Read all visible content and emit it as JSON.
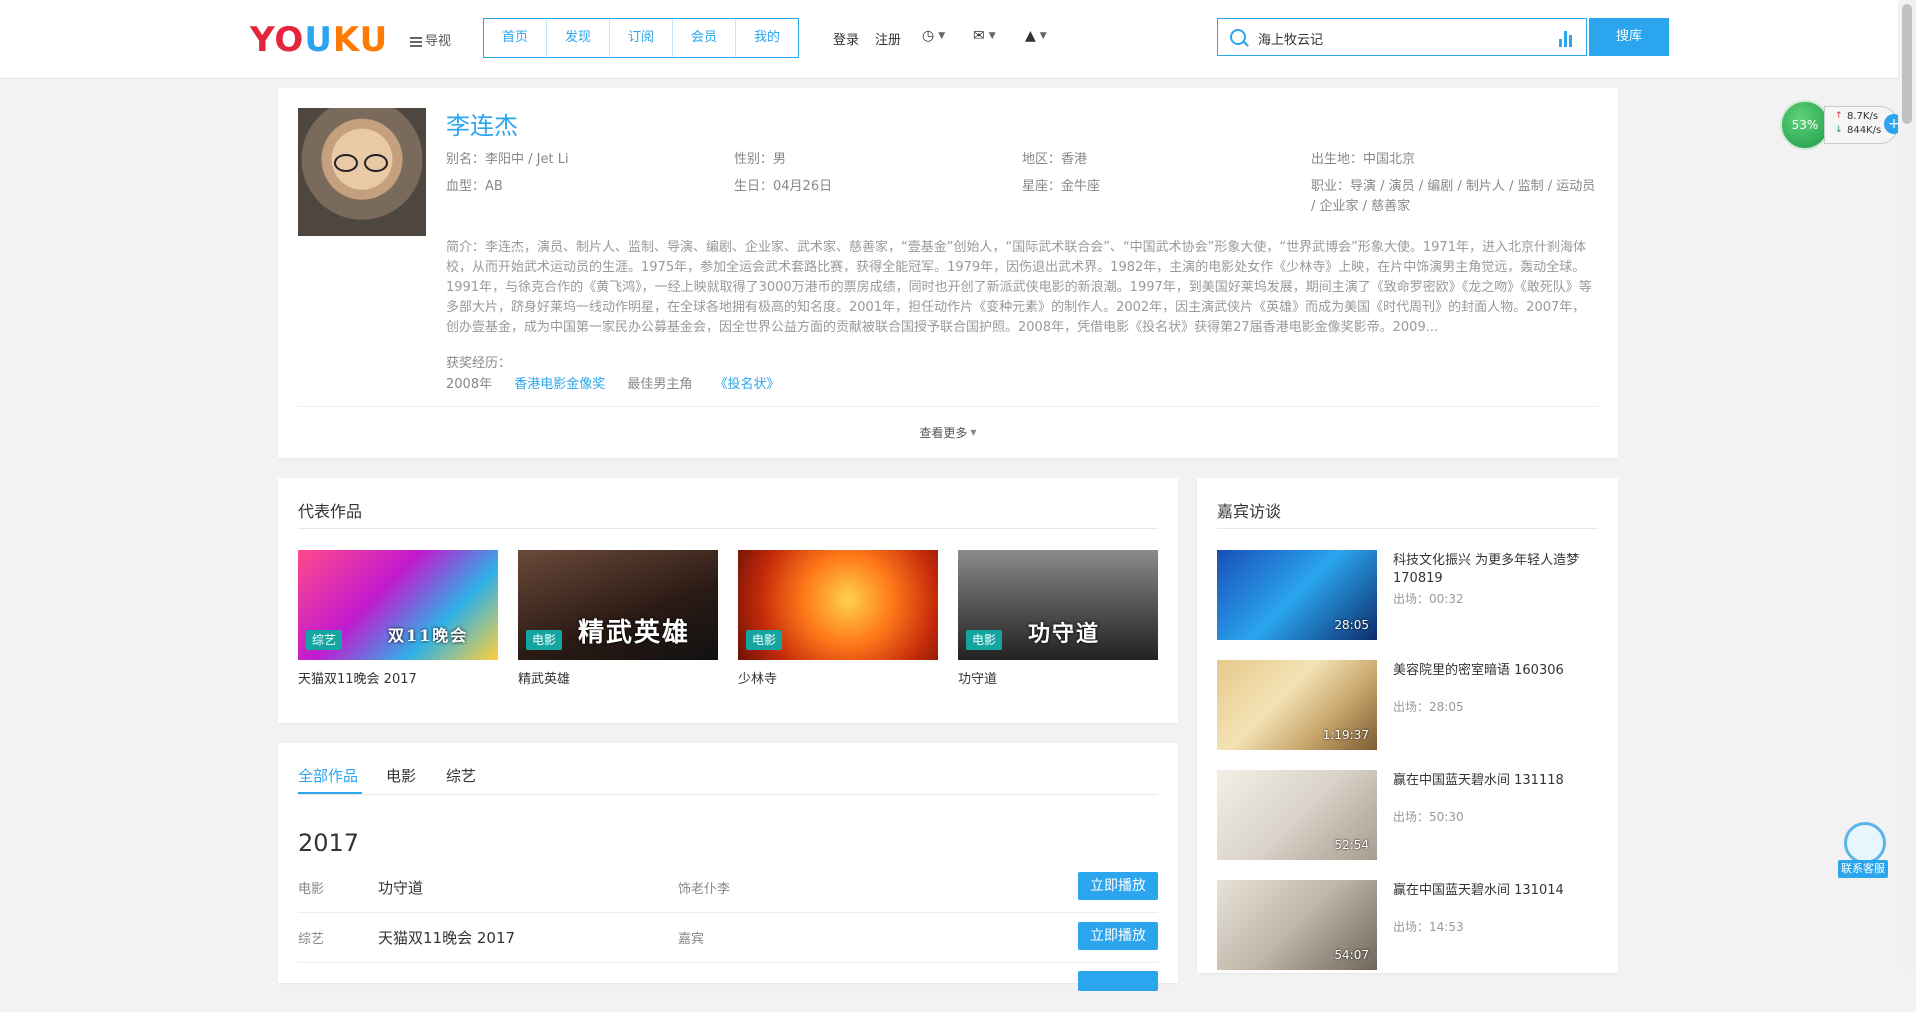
{
  "header": {
    "logo": {
      "part1": "YO",
      "part2": "U",
      "part3": "KU"
    },
    "guide_label": "导视",
    "nav": [
      "首页",
      "发现",
      "订阅",
      "会员",
      "我的"
    ],
    "login": "登录",
    "register": "注册",
    "icons": [
      "history-icon",
      "mail-icon",
      "upload-icon"
    ],
    "search_value": "海上牧云记",
    "search_button": "搜库"
  },
  "profile": {
    "name": "李连杰",
    "alias": "别名：李阳中 / Jet Li",
    "gender": "性别：男",
    "region": "地区：香港",
    "birthplace": "出生地：中国北京",
    "blood": "血型：AB",
    "birthday": "生日：04月26日",
    "constellation": "星座：金牛座",
    "occupation": "职业：导演 / 演员 / 编剧 / 制片人 / 监制 / 运动员 / 企业家 / 慈善家",
    "bio": "简介：李连杰，演员、制片人、监制、导演、编剧、企业家、武术家、慈善家，“壹基金”创始人，“国际武术联合会”、“中国武术协会”形象大使，“世界武博会”形象大使。1971年，进入北京什刹海体校，从而开始武术运动员的生涯。1975年，参加全运会武术套路比赛，获得全能冠军。1979年，因伤退出武术界。1982年，主演的电影处女作《少林寺》上映，在片中饰演男主角觉远，轰动全球。1991年，与徐克合作的《黄飞鸿》，一经上映就取得了3000万港币的票房成绩，同时也开创了新派武侠电影的新浪潮。1997年，到美国好莱坞发展，期间主演了《致命罗密欧》《龙之吻》《敢死队》等多部大片，跻身好莱坞一线动作明星，在全球各地拥有极高的知名度。2001年，担任动作片《变种元素》的制作人。2002年，因主演武侠片《英雄》而成为美国《时代周刊》的封面人物。2007年，创办壹基金，成为中国第一家民办公募基金会，因全世界公益方面的贡献被联合国授予联合国护照。2008年，凭借电影《投名状》获得第27届香港电影金像奖影帝。2009...",
    "award_title": "获奖经历：",
    "award": {
      "year": "2008年",
      "name": "香港电影金像奖",
      "category": "最佳男主角",
      "work": "《投名状》"
    },
    "more": "查看更多"
  },
  "works": {
    "title": "代表作品",
    "items": [
      {
        "tag": "综艺",
        "title": "天猫双11晚会 2017",
        "thumb_text": "双11晚会"
      },
      {
        "tag": "电影",
        "title": "精武英雄",
        "thumb_text": "精武英雄"
      },
      {
        "tag": "电影",
        "title": "少林寺",
        "thumb_text": ""
      },
      {
        "tag": "电影",
        "title": "功守道",
        "thumb_text": "功守道"
      }
    ]
  },
  "guests": {
    "title": "嘉宾访谈",
    "items": [
      {
        "title": "科技文化振兴 为更多年轻人造梦 170819",
        "time": "出场：00:32",
        "duration": "28:05"
      },
      {
        "title": "美容院里的密室暗语 160306",
        "time": "出场：28:05",
        "duration": "1:19:37"
      },
      {
        "title": "赢在中国蓝天碧水间 131118",
        "time": "出场：50:30",
        "duration": "52:54"
      },
      {
        "title": "赢在中国蓝天碧水间 131014",
        "time": "出场：14:53",
        "duration": "54:07"
      }
    ]
  },
  "allworks": {
    "tabs": [
      "全部作品",
      "电影",
      "综艺"
    ],
    "year": "2017",
    "rows": [
      {
        "type": "电影",
        "name": "功守道",
        "role": "饰老仆李",
        "play": "立即播放"
      },
      {
        "type": "综艺",
        "name": "天猫双11晚会 2017",
        "role": "嘉宾",
        "play": "立即播放"
      }
    ]
  },
  "widget": {
    "percent": "53%",
    "up": "8.7K/s",
    "down": "844K/s"
  },
  "service": {
    "label": "联系客服"
  },
  "colors": {
    "accent": "#2aa5ee",
    "tag": "#14a5a0",
    "logo_red": "#e4253c",
    "logo_orange": "#ff7a00"
  }
}
